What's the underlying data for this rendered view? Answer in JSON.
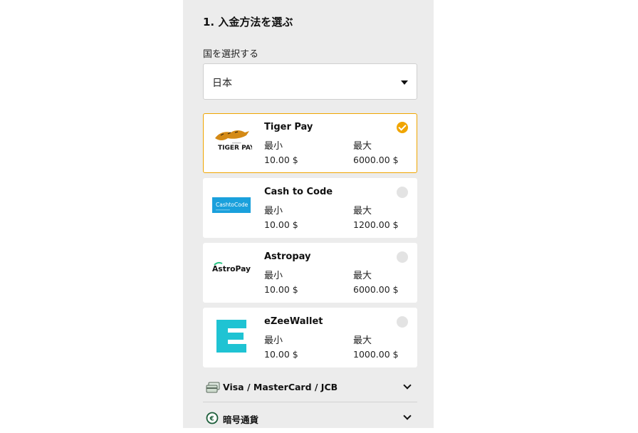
{
  "section_title": "1. 入金方法を選ぶ",
  "country": {
    "label": "国を選択する",
    "value": "日本"
  },
  "methods": [
    {
      "name": "Tiger Pay",
      "min_label": "最小",
      "max_label": "最大",
      "min": "10.00 $",
      "max": "6000.00 $",
      "selected": true,
      "logo_text": "TIGER PAY",
      "icon": "tiger-pay-logo"
    },
    {
      "name": "Cash to Code",
      "min_label": "最小",
      "max_label": "最大",
      "min": "10.00 $",
      "max": "1200.00 $",
      "selected": false,
      "logo_text": "CashtoCode",
      "icon": "cash-to-code-logo"
    },
    {
      "name": "Astropay",
      "min_label": "最小",
      "max_label": "最大",
      "min": "10.00 $",
      "max": "6000.00 $",
      "selected": false,
      "logo_text": "AstroPay",
      "icon": "astropay-logo"
    },
    {
      "name": "eZeeWallet",
      "min_label": "最小",
      "max_label": "最大",
      "min": "10.00 $",
      "max": "1000.00 $",
      "selected": false,
      "icon": "ezeewallet-logo"
    }
  ],
  "accordions": [
    {
      "label": "Visa / MasterCard / JCB",
      "icon": "credit-card-icon"
    },
    {
      "label": "暗号通貨",
      "icon": "crypto-coin-icon"
    }
  ],
  "colors": {
    "accent": "#f0a500",
    "panel_bg": "#ececec",
    "ezee": "#1fc3d3",
    "cashtocode": "#1aa0dc"
  }
}
